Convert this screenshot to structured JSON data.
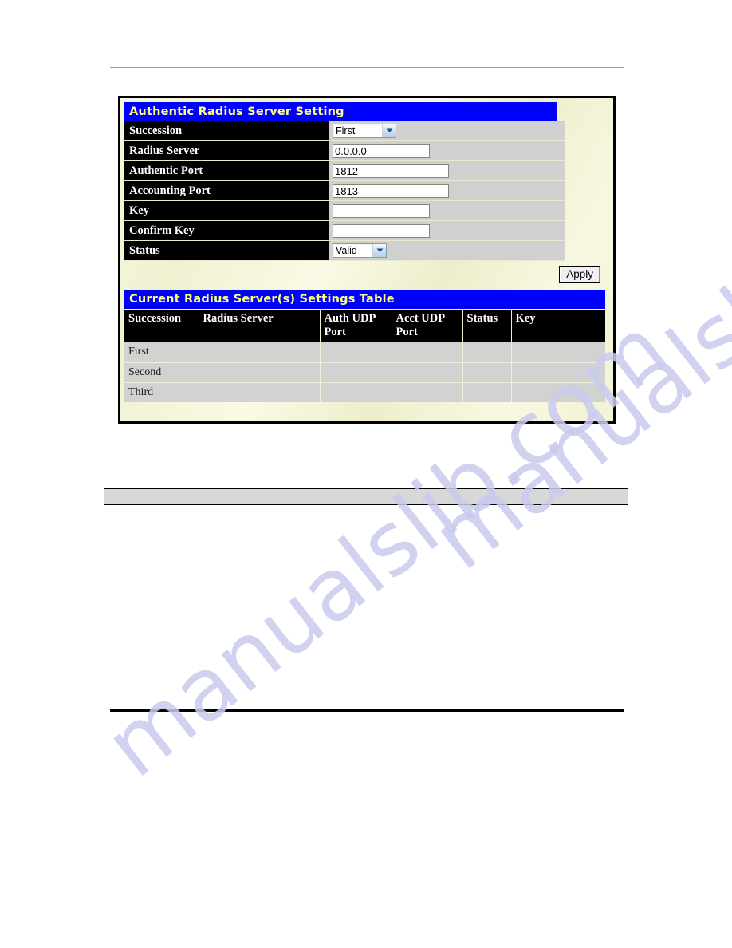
{
  "watermark": {
    "text": "manualslib.com",
    "color": "#c9cbee"
  },
  "panel": {
    "settings_section": {
      "title": "Authentic Radius Server Setting",
      "rows": [
        {
          "label": "Succession",
          "control": "select",
          "value": "First"
        },
        {
          "label": "Radius Server",
          "control": "text",
          "value": "0.0.0.0"
        },
        {
          "label": "Authentic Port",
          "control": "text",
          "value": "1812"
        },
        {
          "label": "Accounting Port",
          "control": "text",
          "value": "1813"
        },
        {
          "label": "Key",
          "control": "text",
          "value": ""
        },
        {
          "label": "Confirm Key",
          "control": "text",
          "value": ""
        },
        {
          "label": "Status",
          "control": "select",
          "value": "Valid"
        }
      ],
      "apply_label": "Apply"
    },
    "results_section": {
      "title": "Current Radius Server(s) Settings Table",
      "columns": [
        "Succession",
        "Radius Server",
        "Auth UDP Port",
        "Acct UDP Port",
        "Status",
        "Key"
      ],
      "rows": [
        {
          "succession": "First",
          "radius_server": "",
          "auth_udp_port": "",
          "acct_udp_port": "",
          "status": "",
          "key": ""
        },
        {
          "succession": "Second",
          "radius_server": "",
          "auth_udp_port": "",
          "acct_udp_port": "",
          "status": "",
          "key": ""
        },
        {
          "succession": "Third",
          "radius_server": "",
          "auth_udp_port": "",
          "acct_udp_port": "",
          "status": "",
          "key": ""
        }
      ]
    }
  },
  "colors": {
    "titlebar_bg": "#0000ff",
    "titlebar_fg": "#ffff80",
    "label_bg": "#000000",
    "label_fg": "#ffffff",
    "value_bg": "#d0d0d0",
    "panel_bg": "#f3f3d8"
  }
}
